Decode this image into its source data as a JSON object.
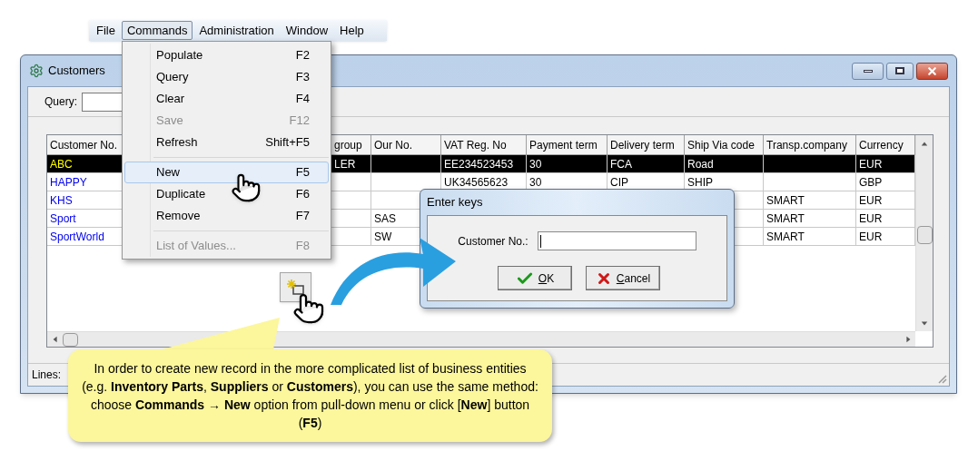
{
  "menu_bar": [
    {
      "label": "File",
      "selected": false
    },
    {
      "label": "Commands",
      "selected": true
    },
    {
      "label": "Administration",
      "selected": false
    },
    {
      "label": "Window",
      "selected": false
    },
    {
      "label": "Help",
      "selected": false
    }
  ],
  "commands_menu": [
    {
      "kind": "item",
      "label": "Populate",
      "shortcut": "F2",
      "disabled": false,
      "selected": false
    },
    {
      "kind": "item",
      "label": "Query",
      "shortcut": "F3",
      "disabled": false,
      "selected": false
    },
    {
      "kind": "item",
      "label": "Clear",
      "shortcut": "F4",
      "disabled": false,
      "selected": false
    },
    {
      "kind": "item",
      "label": "Save",
      "shortcut": "F12",
      "disabled": true,
      "selected": false
    },
    {
      "kind": "item",
      "label": "Refresh",
      "shortcut": "Shift+F5",
      "disabled": false,
      "selected": false
    },
    {
      "kind": "separator"
    },
    {
      "kind": "item",
      "label": "New",
      "shortcut": "F5",
      "disabled": false,
      "selected": true
    },
    {
      "kind": "item",
      "label": "Duplicate",
      "shortcut": "F6",
      "disabled": false,
      "selected": false
    },
    {
      "kind": "item",
      "label": "Remove",
      "shortcut": "F7",
      "disabled": false,
      "selected": false
    },
    {
      "kind": "separator"
    },
    {
      "kind": "item",
      "label": "List of Values...",
      "shortcut": "F8",
      "disabled": true,
      "selected": false
    }
  ],
  "window": {
    "title": "Customers",
    "query_label": "Query:",
    "status_label": "Lines:"
  },
  "table": {
    "columns": [
      "Customer No.",
      "group",
      "Our No.",
      "VAT Reg. No",
      "Payment term",
      "Delivery term",
      "Ship Via code",
      "Transp.company",
      "Currency"
    ],
    "rows": [
      {
        "selected": true,
        "customer_no": "ABC",
        "group": "LER",
        "vat": "EE234523453",
        "payment_term": "30",
        "delivery_term": "FCA",
        "ship_via": "Road",
        "currency": "EUR"
      },
      {
        "selected": false,
        "customer_no": "HAPPY",
        "vat": "UK34565623",
        "payment_term": "30",
        "delivery_term": "CIP",
        "ship_via": "SHIP",
        "currency": "GBP"
      },
      {
        "selected": false,
        "customer_no": "KHS",
        "transp_company": "SMART",
        "currency": "EUR"
      },
      {
        "selected": false,
        "customer_no": "Sport",
        "our_no": "SAS",
        "transp_company": "SMART",
        "currency": "EUR"
      },
      {
        "selected": false,
        "customer_no": "SportWorld",
        "our_no": "SW",
        "transp_company": "SMART",
        "currency": "EUR"
      }
    ]
  },
  "dialog": {
    "title": "Enter keys",
    "field_label": "Customer No.:",
    "buttons": [
      {
        "kind": "ok",
        "label": "OK"
      },
      {
        "kind": "cancel",
        "label": "Cancel"
      }
    ]
  },
  "callout": "In order to create new record in the more complicated list of business entities (e.g. **Inventory Parts**, **Suppliers** or **Customers**), you can use the same method: choose **Commands → New** option from pull-down menu or click [**New**] button (**F5**)"
}
